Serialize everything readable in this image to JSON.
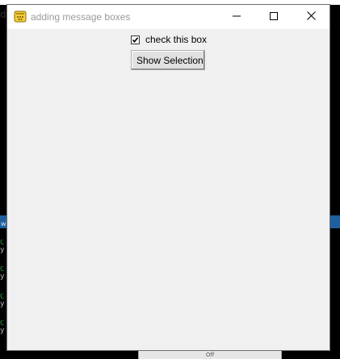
{
  "window": {
    "title": "adding message boxes",
    "controls": {
      "minimize": "minimize-icon",
      "maximize": "maximize-icon",
      "close": "close-icon"
    }
  },
  "form": {
    "checkbox": {
      "label": "check this box",
      "checked": true
    },
    "button": {
      "label": "Show Selection"
    }
  },
  "background": {
    "left_char": "d",
    "bottom_tab": "Off",
    "band_text": "w"
  },
  "colors": {
    "window_bg": "#f0f0f0",
    "titlebar_bg": "#ffffff",
    "title_text": "#9a9a9a",
    "desktop_bg": "#000000",
    "band_blue": "#1f5f9e"
  }
}
